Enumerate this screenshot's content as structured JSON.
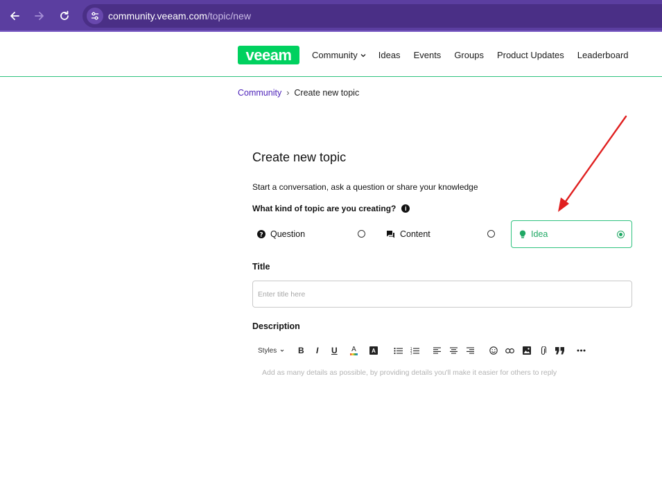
{
  "browser": {
    "url_domain": "community.veeam.com",
    "url_path": "/topic/new"
  },
  "header": {
    "logo_text": "veeam",
    "nav": [
      {
        "label": "Community"
      },
      {
        "label": "Ideas"
      },
      {
        "label": "Events"
      },
      {
        "label": "Groups"
      },
      {
        "label": "Product Updates"
      },
      {
        "label": "Leaderboard"
      }
    ]
  },
  "breadcrumb": {
    "parent": "Community",
    "separator": "›",
    "current": "Create new topic"
  },
  "form": {
    "title": "Create new topic",
    "subtitle": "Start a conversation, ask a question or share your knowledge",
    "topic_question": "What kind of topic are you creating?",
    "info_glyph": "i",
    "topic_types": [
      {
        "label": "Question",
        "icon": "question-circle-icon",
        "selected": false
      },
      {
        "label": "Content",
        "icon": "chat-bubbles-icon",
        "selected": false
      },
      {
        "label": "Idea",
        "icon": "lightbulb-icon",
        "selected": true
      }
    ],
    "title_label": "Title",
    "title_placeholder": "Enter title here",
    "description_label": "Description",
    "toolbar": {
      "styles_label": "Styles",
      "bold_label": "B",
      "italic_label": "I",
      "underline_label": "U",
      "font_color_label": "A",
      "highlight_label": "A"
    },
    "description_placeholder": "Add as many details as possible, by providing details you'll make it easier for others to reply"
  },
  "colors": {
    "browser_purple": "#5b3ea0",
    "brand_green": "#00d15f",
    "selected_green": "#1fa864",
    "link_purple": "#4a1fb8",
    "annotation_red": "#e02020"
  }
}
